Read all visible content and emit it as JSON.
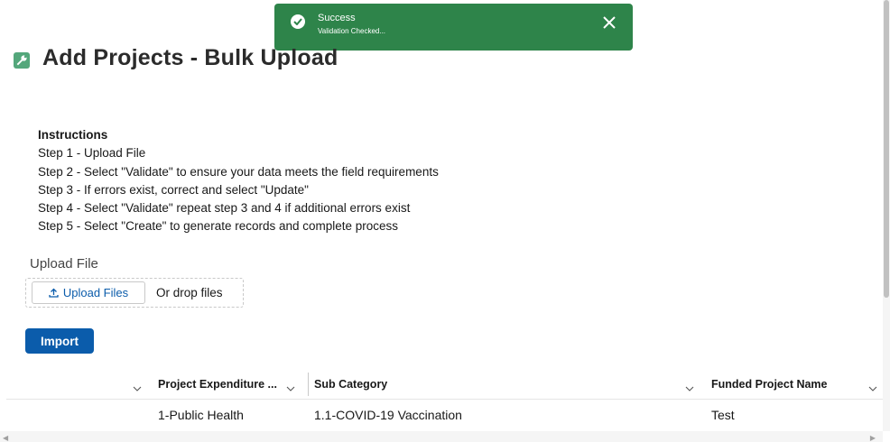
{
  "toast": {
    "title": "Success",
    "message": "Validation Checked..."
  },
  "header": {
    "title": "Add Projects - Bulk Upload"
  },
  "instructions": {
    "heading": "Instructions",
    "steps": [
      "Step 1 - Upload File",
      "Step 2 - Select \"Validate\" to ensure your data meets the field requirements",
      "Step 3 - If errors exist, correct and select \"Update\"",
      "Step 4 - Select \"Validate\" repeat step 3 and 4 if additional errors exist",
      "Step 5 - Select \"Create\" to generate records and complete process"
    ]
  },
  "upload": {
    "label": "Upload File",
    "button_label": "Upload Files",
    "drop_text": "Or drop files"
  },
  "import_button": "Import",
  "table": {
    "columns": [
      "Project Expenditure ...",
      "Sub Category",
      "Funded Project Name"
    ],
    "rows": [
      [
        "1-Public Health",
        "1.1-COVID-19 Vaccination",
        "Test"
      ]
    ]
  },
  "colors": {
    "toast_bg": "#2e844a",
    "brand_button": "#0b5cab",
    "header_icon": "#54a77b"
  }
}
